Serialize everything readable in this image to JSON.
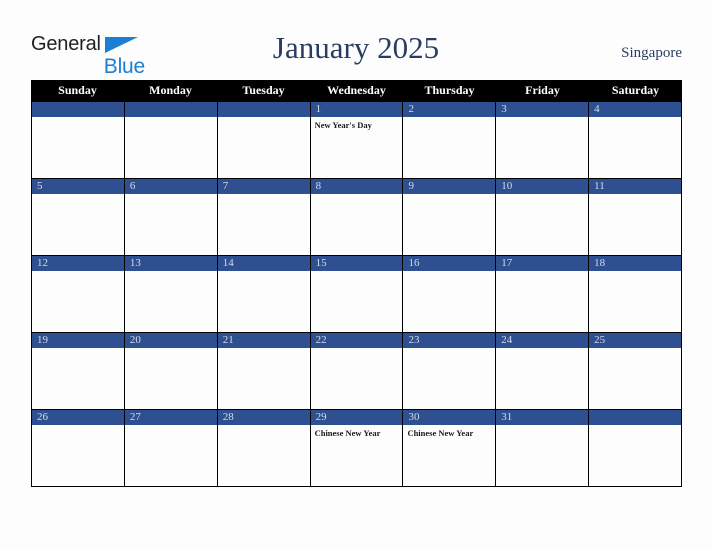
{
  "brand": {
    "name_part1": "General",
    "name_part2": "Blue",
    "triangle_icon": "triangle-icon",
    "triangle_color": "#1b7fd4",
    "text_color": "#231f20"
  },
  "header": {
    "title": "January 2025",
    "country": "Singapore",
    "title_color": "#2b3c63"
  },
  "colors": {
    "dow_header_bg": "#000000",
    "dow_header_text": "#ffffff",
    "daynum_bar_bg": "#2e5090",
    "daynum_text": "#d5dbe8",
    "grid_line": "#000000",
    "page_bg": "#fdfdfd"
  },
  "calendar": {
    "weekdays": [
      "Sunday",
      "Monday",
      "Tuesday",
      "Wednesday",
      "Thursday",
      "Friday",
      "Saturday"
    ],
    "weeks": [
      [
        {
          "day": "",
          "events": []
        },
        {
          "day": "",
          "events": []
        },
        {
          "day": "",
          "events": []
        },
        {
          "day": "1",
          "events": [
            "New Year's Day"
          ]
        },
        {
          "day": "2",
          "events": []
        },
        {
          "day": "3",
          "events": []
        },
        {
          "day": "4",
          "events": []
        }
      ],
      [
        {
          "day": "5",
          "events": []
        },
        {
          "day": "6",
          "events": []
        },
        {
          "day": "7",
          "events": []
        },
        {
          "day": "8",
          "events": []
        },
        {
          "day": "9",
          "events": []
        },
        {
          "day": "10",
          "events": []
        },
        {
          "day": "11",
          "events": []
        }
      ],
      [
        {
          "day": "12",
          "events": []
        },
        {
          "day": "13",
          "events": []
        },
        {
          "day": "14",
          "events": []
        },
        {
          "day": "15",
          "events": []
        },
        {
          "day": "16",
          "events": []
        },
        {
          "day": "17",
          "events": []
        },
        {
          "day": "18",
          "events": []
        }
      ],
      [
        {
          "day": "19",
          "events": []
        },
        {
          "day": "20",
          "events": []
        },
        {
          "day": "21",
          "events": []
        },
        {
          "day": "22",
          "events": []
        },
        {
          "day": "23",
          "events": []
        },
        {
          "day": "24",
          "events": []
        },
        {
          "day": "25",
          "events": []
        }
      ],
      [
        {
          "day": "26",
          "events": []
        },
        {
          "day": "27",
          "events": []
        },
        {
          "day": "28",
          "events": []
        },
        {
          "day": "29",
          "events": [
            "Chinese New Year"
          ]
        },
        {
          "day": "30",
          "events": [
            "Chinese New Year"
          ]
        },
        {
          "day": "31",
          "events": []
        },
        {
          "day": "",
          "events": []
        }
      ]
    ]
  }
}
